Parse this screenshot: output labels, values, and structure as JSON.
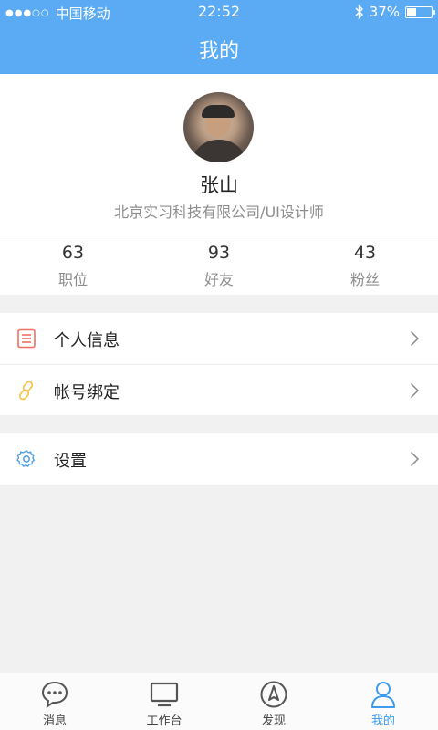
{
  "status_bar": {
    "signal": "●●●○○",
    "carrier": "中国移动",
    "time": "22:52",
    "bluetooth_icon": "bluetooth-icon",
    "battery_text": "37%",
    "battery_level": 0.37
  },
  "header": {
    "title": "我的",
    "background": "#5aabf4"
  },
  "profile": {
    "name": "张山",
    "company": "北京实习科技有限公司/UI设计师",
    "stats": [
      {
        "value": "63",
        "label": "职位"
      },
      {
        "value": "93",
        "label": "好友"
      },
      {
        "value": "43",
        "label": "粉丝"
      }
    ]
  },
  "menu": {
    "group1": [
      {
        "label": "个人信息",
        "icon": "profile-document-icon",
        "color": "#ef6f62"
      },
      {
        "label": "帐号绑定",
        "icon": "link-icon",
        "color": "#f6c040"
      }
    ],
    "group2": [
      {
        "label": "设置",
        "icon": "gear-icon",
        "color": "#4a9ee8"
      }
    ]
  },
  "tab_bar": {
    "active_color": "#3b9bf0",
    "items": [
      {
        "label": "消息",
        "icon": "chat-bubble-icon"
      },
      {
        "label": "工作台",
        "icon": "monitor-icon"
      },
      {
        "label": "发现",
        "icon": "compass-icon"
      },
      {
        "label": "我的",
        "icon": "user-icon",
        "active": true
      }
    ]
  }
}
